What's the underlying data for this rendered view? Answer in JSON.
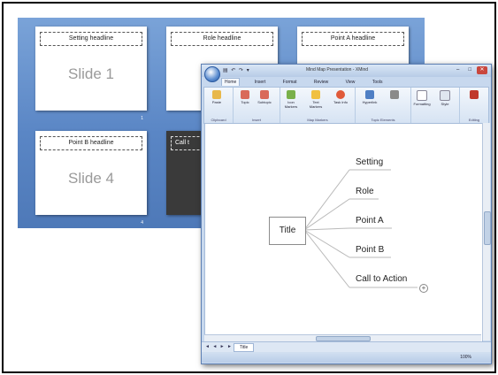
{
  "slides": [
    {
      "headline": "Setting headline",
      "label": "Slide 1"
    },
    {
      "headline": "Role headline",
      "label": ""
    },
    {
      "headline": "Point A headline",
      "label": ""
    },
    {
      "headline": "Point B headline",
      "label": "Slide 4"
    },
    {
      "headline": "Call t",
      "label": ""
    }
  ],
  "slide_numbers": [
    "1",
    "4"
  ],
  "window": {
    "title": "Mind Map Presentation - XMind",
    "quick_access": "▤ ↶ ↷ ▾",
    "controls": {
      "minimize": "–",
      "maximize": "□",
      "close": "✕"
    }
  },
  "ribbon": {
    "tabs": [
      "Home",
      "Insert",
      "Format",
      "Review",
      "View",
      "Tools"
    ],
    "active_tab": "Home",
    "buttons": {
      "paste": "Paste",
      "topic": "Topic",
      "subtopic": "Subtopic",
      "icon_markers": "Icon Markers",
      "text_markers": "Text Markers",
      "task_info": "Task Info",
      "hyperlink": "Hyperlink",
      "formatting": "Formatting",
      "style": "Style"
    },
    "groups": [
      "Clipboard",
      "Insert",
      "Map Markers",
      "Topic Elements",
      "Editing"
    ]
  },
  "mindmap": {
    "central": "Title",
    "topics": [
      "Setting",
      "Role",
      "Point A",
      "Point B",
      "Call to Action"
    ]
  },
  "sheet": {
    "nav": "◄ ◄ ► ►",
    "tab": "Title"
  },
  "status": {
    "zoom": "100%"
  },
  "colors": {
    "sorter_bg": "#5a86c5",
    "window_chrome": "#c7d8ee",
    "close_button": "#c9473d"
  }
}
